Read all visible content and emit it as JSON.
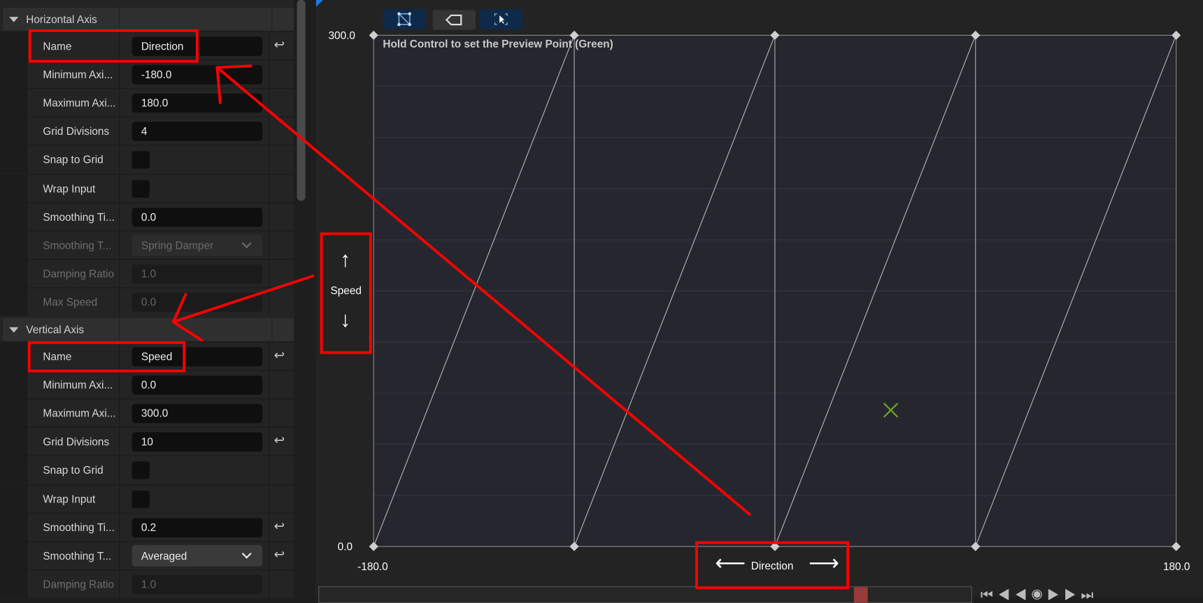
{
  "horizontal_axis": {
    "header": "Horizontal Axis",
    "rows": [
      {
        "label": "Name",
        "type": "text",
        "value": "Direction",
        "revert": true
      },
      {
        "label": "Minimum Axi...",
        "type": "text",
        "value": "-180.0"
      },
      {
        "label": "Maximum Axi...",
        "type": "text",
        "value": "180.0"
      },
      {
        "label": "Grid Divisions",
        "type": "text",
        "value": "4"
      },
      {
        "label": "Snap to Grid",
        "type": "checkbox",
        "checked": false
      },
      {
        "label": "Wrap Input",
        "type": "checkbox",
        "checked": false
      },
      {
        "label": "Smoothing Ti...",
        "type": "text",
        "value": "0.0"
      },
      {
        "label": "Smoothing T...",
        "type": "select",
        "value": "Spring Damper",
        "disabled": true
      },
      {
        "label": "Damping Ratio",
        "type": "text",
        "value": "1.0",
        "disabled": true
      },
      {
        "label": "Max Speed",
        "type": "text",
        "value": "0.0",
        "disabled": true
      }
    ]
  },
  "vertical_axis": {
    "header": "Vertical Axis",
    "rows": [
      {
        "label": "Name",
        "type": "text",
        "value": "Speed",
        "revert": true
      },
      {
        "label": "Minimum Axi...",
        "type": "text",
        "value": "0.0"
      },
      {
        "label": "Maximum Axi...",
        "type": "text",
        "value": "300.0"
      },
      {
        "label": "Grid Divisions",
        "type": "text",
        "value": "10",
        "revert": true
      },
      {
        "label": "Snap to Grid",
        "type": "checkbox",
        "checked": false
      },
      {
        "label": "Wrap Input",
        "type": "checkbox",
        "checked": false
      },
      {
        "label": "Smoothing Ti...",
        "type": "text",
        "value": "0.2",
        "revert": true
      },
      {
        "label": "Smoothing T...",
        "type": "select",
        "value": "Averaged",
        "revert": true
      },
      {
        "label": "Damping Ratio",
        "type": "text",
        "value": "1.0",
        "disabled": true
      }
    ]
  },
  "graph": {
    "hint": "Hold Control to set the Preview Point (Green)",
    "x_axis_name": "Direction",
    "y_axis_name": "Speed",
    "x_min_label": "-180.0",
    "x_max_label": "180.0",
    "y_min_label": "0.0",
    "y_max_label": "300.0",
    "x_range": [
      -180,
      180
    ],
    "y_range": [
      0,
      300
    ],
    "x_divisions": 4,
    "y_divisions": 10,
    "sample_points": [
      [
        -180,
        0
      ],
      [
        -90,
        0
      ],
      [
        0,
        0
      ],
      [
        90,
        0
      ],
      [
        180,
        0
      ],
      [
        -180,
        300
      ],
      [
        -90,
        300
      ],
      [
        0,
        300
      ],
      [
        90,
        300
      ],
      [
        180,
        300
      ]
    ],
    "triangle_edges": [
      [
        [
          -180,
          0
        ],
        [
          -90,
          300
        ]
      ],
      [
        [
          -90,
          0
        ],
        [
          0,
          300
        ]
      ],
      [
        [
          0,
          0
        ],
        [
          90,
          300
        ]
      ],
      [
        [
          90,
          0
        ],
        [
          180,
          300
        ]
      ]
    ],
    "preview_point": [
      52,
      80
    ],
    "preview_color": "#6fa52a",
    "toolbar": [
      "triangulation-icon",
      "tag-icon",
      "select-icon"
    ]
  },
  "annotation_color": "#ff0000"
}
